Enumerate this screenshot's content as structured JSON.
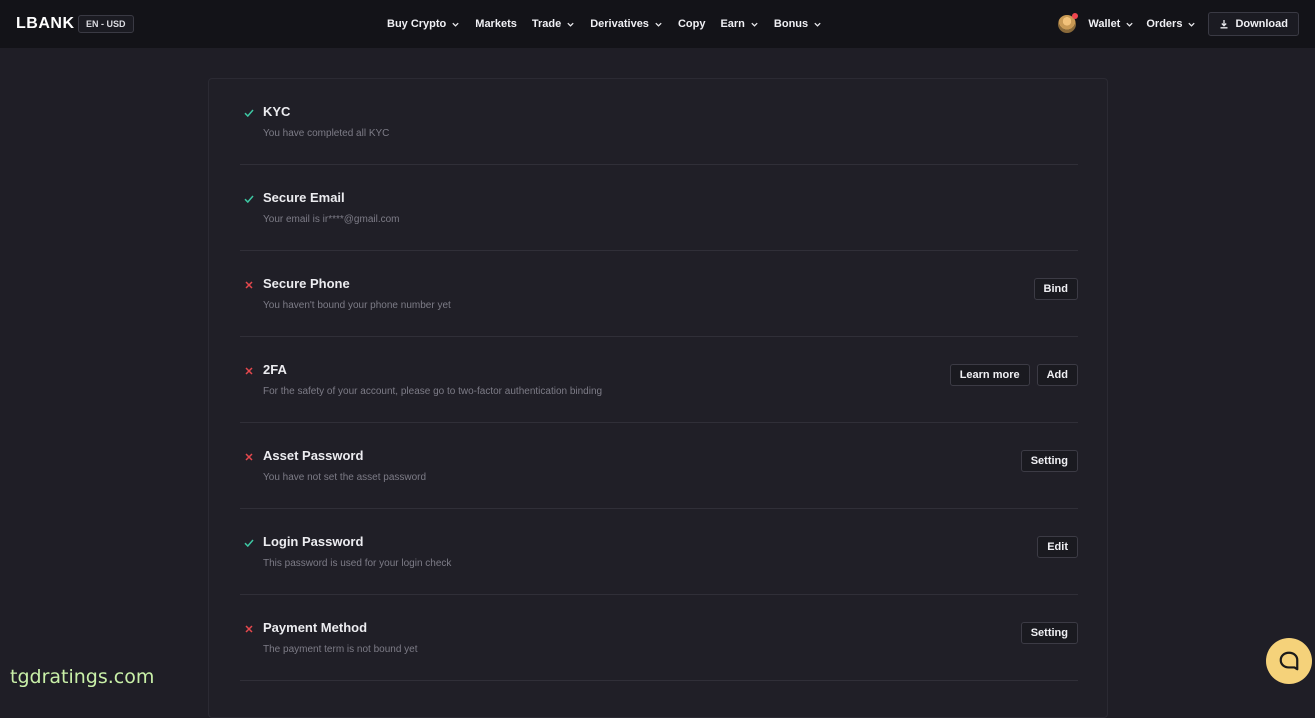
{
  "header": {
    "logo": "LBANK",
    "lang_currency": "EN - USD",
    "nav": [
      {
        "label": "Buy Crypto",
        "dropdown": true
      },
      {
        "label": "Markets",
        "dropdown": false
      },
      {
        "label": "Trade",
        "dropdown": true
      },
      {
        "label": "Derivatives",
        "dropdown": true
      },
      {
        "label": "Copy",
        "dropdown": false
      },
      {
        "label": "Earn",
        "dropdown": true
      },
      {
        "label": "Bonus",
        "dropdown": true
      }
    ],
    "wallet_label": "Wallet",
    "orders_label": "Orders",
    "download_label": "Download"
  },
  "security": {
    "items": [
      {
        "title": "KYC",
        "desc": "You have completed all KYC",
        "status": "done",
        "actions": []
      },
      {
        "title": "Secure Email",
        "desc": "Your email is ir****@gmail.com",
        "status": "done",
        "actions": []
      },
      {
        "title": "Secure Phone",
        "desc": "You haven't bound your phone number yet",
        "status": "missing",
        "actions": [
          "Bind"
        ]
      },
      {
        "title": "2FA",
        "desc": "For the safety of your account, please go to two-factor authentication binding",
        "status": "missing",
        "actions": [
          "Learn more",
          "Add"
        ]
      },
      {
        "title": "Asset Password",
        "desc": "You have not set the asset password",
        "status": "missing",
        "actions": [
          "Setting"
        ]
      },
      {
        "title": "Login Password",
        "desc": "This password is used for your login check",
        "status": "done",
        "actions": [
          "Edit"
        ]
      },
      {
        "title": "Payment Method",
        "desc": "The payment term is not bound yet",
        "status": "missing",
        "actions": [
          "Setting"
        ]
      }
    ]
  },
  "watermark": "tgdratings.com",
  "colors": {
    "done": "#3ec7a3",
    "missing": "#e5484d",
    "chat_button": "#f5d27a"
  }
}
